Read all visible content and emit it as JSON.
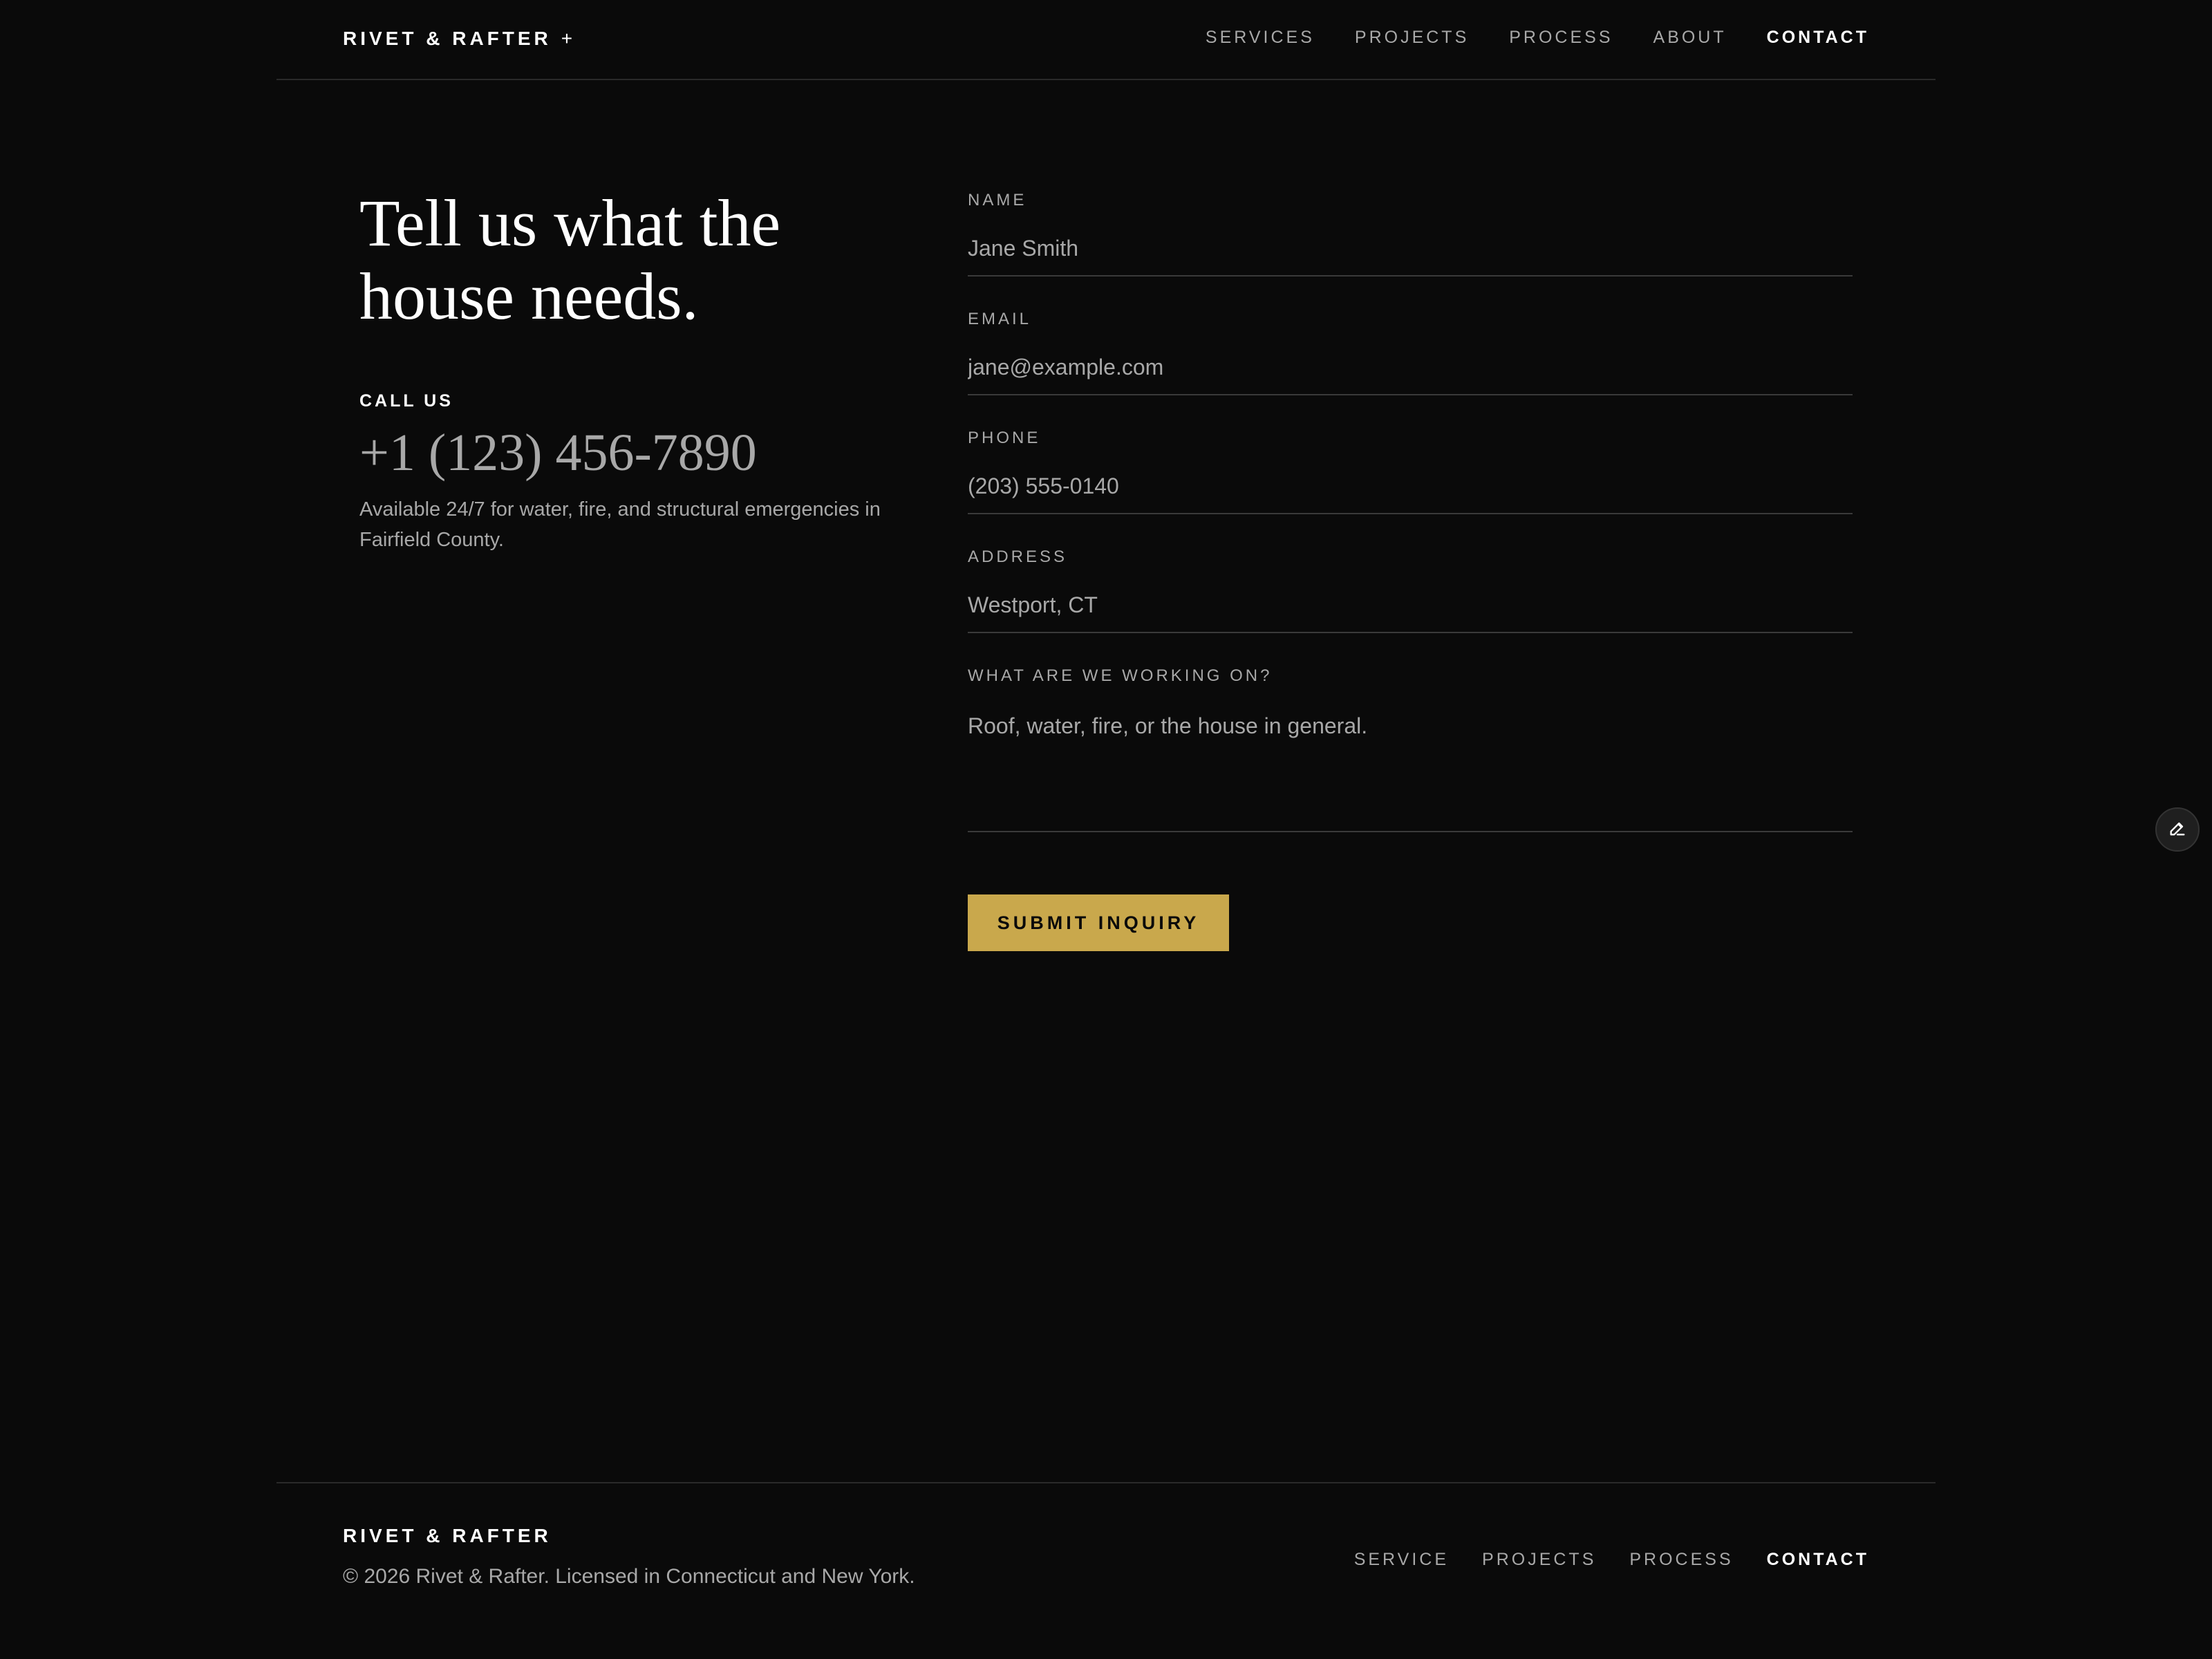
{
  "header": {
    "brand": "RIVET & RAFTER",
    "brand_mark": "+",
    "nav": [
      {
        "label": "SERVICES",
        "active": false
      },
      {
        "label": "PROJECTS",
        "active": false
      },
      {
        "label": "PROCESS",
        "active": false
      },
      {
        "label": "ABOUT",
        "active": false
      },
      {
        "label": "CONTACT",
        "active": true
      }
    ]
  },
  "intro": {
    "headline": "Tell us what the house needs.",
    "call_label": "CALL US",
    "phone": "+1 (123) 456-7890",
    "availability": "Available 24/7 for water, fire, and structural emergencies in Fairfield County."
  },
  "form": {
    "fields": {
      "name": {
        "label": "NAME",
        "placeholder": "Jane Smith"
      },
      "email": {
        "label": "EMAIL",
        "placeholder": "jane@example.com"
      },
      "phone": {
        "label": "PHONE",
        "placeholder": "(203) 555-0140"
      },
      "address": {
        "label": "ADDRESS",
        "placeholder": "Westport, CT"
      },
      "message": {
        "label": "WHAT ARE WE WORKING ON?",
        "placeholder": "Roof, water, fire, or the house in general."
      }
    },
    "submit_label": "SUBMIT INQUIRY"
  },
  "footer": {
    "brand": "RIVET & RAFTER",
    "copyright": "© 2026 Rivet & Rafter. Licensed in Connecticut and New York.",
    "nav": [
      {
        "label": "SERVICE",
        "active": false
      },
      {
        "label": "PROJECTS",
        "active": false
      },
      {
        "label": "PROCESS",
        "active": false
      },
      {
        "label": "CONTACT",
        "active": true
      }
    ]
  },
  "colors": {
    "background": "#0a0a0a",
    "accent": "#c9a84c",
    "muted_text": "#a8a8a8",
    "divider": "#2a2a2a"
  },
  "icons": {
    "edit_button": "pencil-icon"
  }
}
